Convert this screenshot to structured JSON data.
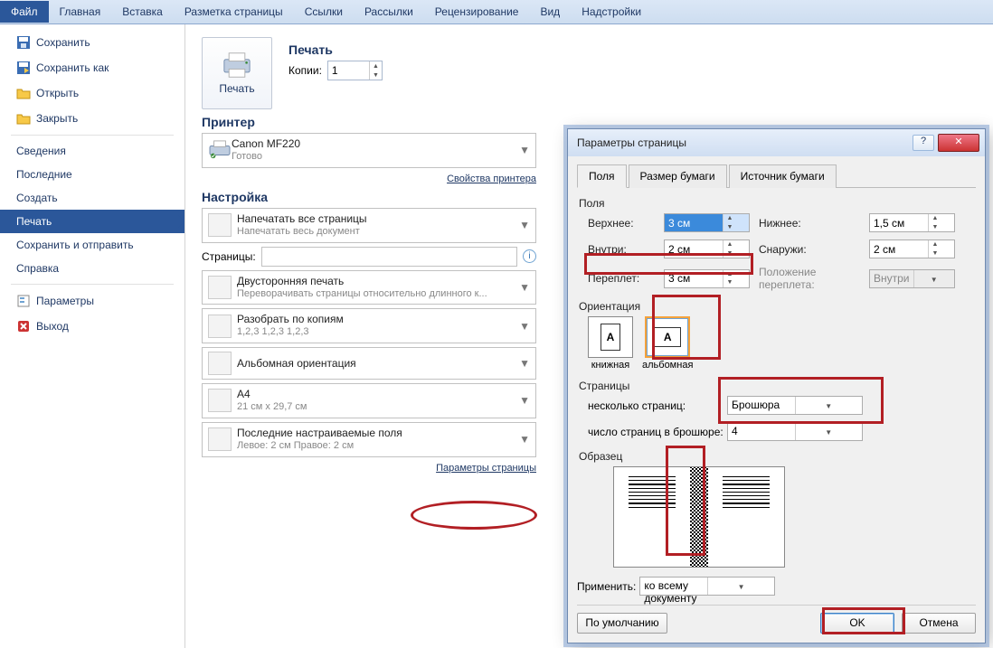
{
  "ribbon": {
    "tabs": [
      "Файл",
      "Главная",
      "Вставка",
      "Разметка страницы",
      "Ссылки",
      "Рассылки",
      "Рецензирование",
      "Вид",
      "Надстройки"
    ],
    "active": 0
  },
  "sidebar": {
    "items": [
      {
        "label": "Сохранить",
        "icon": "save-icon"
      },
      {
        "label": "Сохранить как",
        "icon": "save-as-icon"
      },
      {
        "label": "Открыть",
        "icon": "open-icon"
      },
      {
        "label": "Закрыть",
        "icon": "close-file-icon"
      }
    ],
    "items2": [
      {
        "label": "Сведения"
      },
      {
        "label": "Последние"
      },
      {
        "label": "Создать"
      },
      {
        "label": "Печать",
        "selected": true
      },
      {
        "label": "Сохранить и отправить"
      },
      {
        "label": "Справка"
      }
    ],
    "items3": [
      {
        "label": "Параметры",
        "icon": "options-icon"
      },
      {
        "label": "Выход",
        "icon": "exit-icon"
      }
    ]
  },
  "print": {
    "title": "Печать",
    "print_button": "Печать",
    "copies_label": "Копии:",
    "copies_value": "1",
    "printer_title": "Принтер",
    "printer_name": "Canon MF220",
    "printer_status": "Готово",
    "printer_props": "Свойства принтера",
    "settings_title": "Настройка",
    "combo1_main": "Напечатать все страницы",
    "combo1_sub": "Напечатать весь документ",
    "pages_label": "Страницы:",
    "combo2_main": "Двусторонняя печать",
    "combo2_sub": "Переворачивать страницы относительно длинного к...",
    "combo3_main": "Разобрать по копиям",
    "combo3_sub": "1,2,3   1,2,3   1,2,3",
    "combo4_main": "Альбомная ориентация",
    "combo5_main": "A4",
    "combo5_sub": "21 см x 29,7 см",
    "combo6_main": "Последние настраиваемые поля",
    "combo6_sub": "Левое: 2 см   Правое: 2 см",
    "page_setup_link": "Параметры страницы"
  },
  "dialog": {
    "title": "Параметры страницы",
    "tabs": [
      "Поля",
      "Размер бумаги",
      "Источник бумаги"
    ],
    "group_fields": "Поля",
    "group_orient": "Ориентация",
    "group_pages": "Страницы",
    "group_preview": "Образец",
    "label_top": "Верхнее:",
    "label_bottom": "Нижнее:",
    "label_inside": "Внутри:",
    "label_outside": "Снаружи:",
    "label_gutter": "Переплет:",
    "label_gutter_pos": "Положение переплета:",
    "val_top": "3 см",
    "val_bottom": "1,5 см",
    "val_inside": "2 см",
    "val_outside": "2 см",
    "val_gutter": "3 см",
    "val_gutter_pos": "Внутри",
    "orient_portrait": "книжная",
    "orient_landscape": "альбомная",
    "pages_multi_label": "несколько страниц:",
    "pages_multi_value": "Брошюра",
    "pages_sheets_label": "число страниц в брошюре:",
    "pages_sheets_value": "4",
    "apply_label": "Применить:",
    "apply_value": "ко всему документу",
    "btn_default": "По умолчанию",
    "btn_ok": "OK",
    "btn_cancel": "Отмена"
  }
}
